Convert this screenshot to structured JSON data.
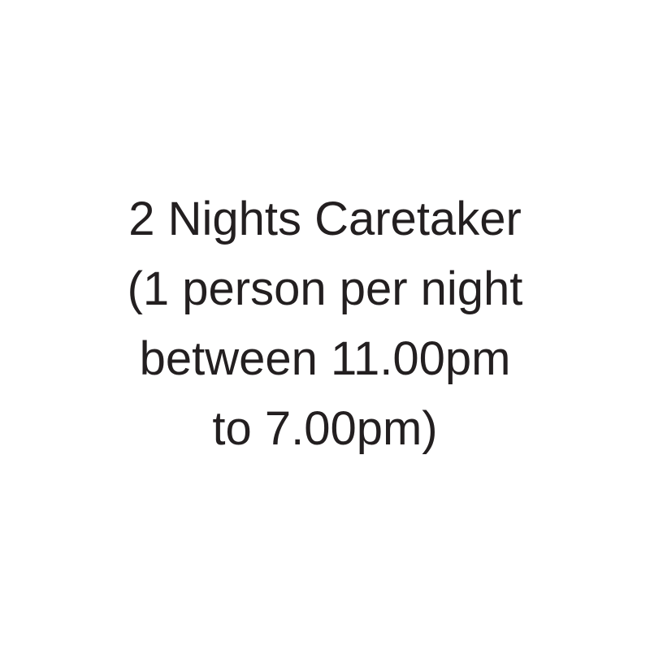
{
  "lines": [
    "2 Nights Caretaker",
    "(1 person per night",
    "between 11.00pm",
    "to 7.00pm)"
  ],
  "colors": {
    "background": "#ffffff",
    "text": "#231f20"
  }
}
